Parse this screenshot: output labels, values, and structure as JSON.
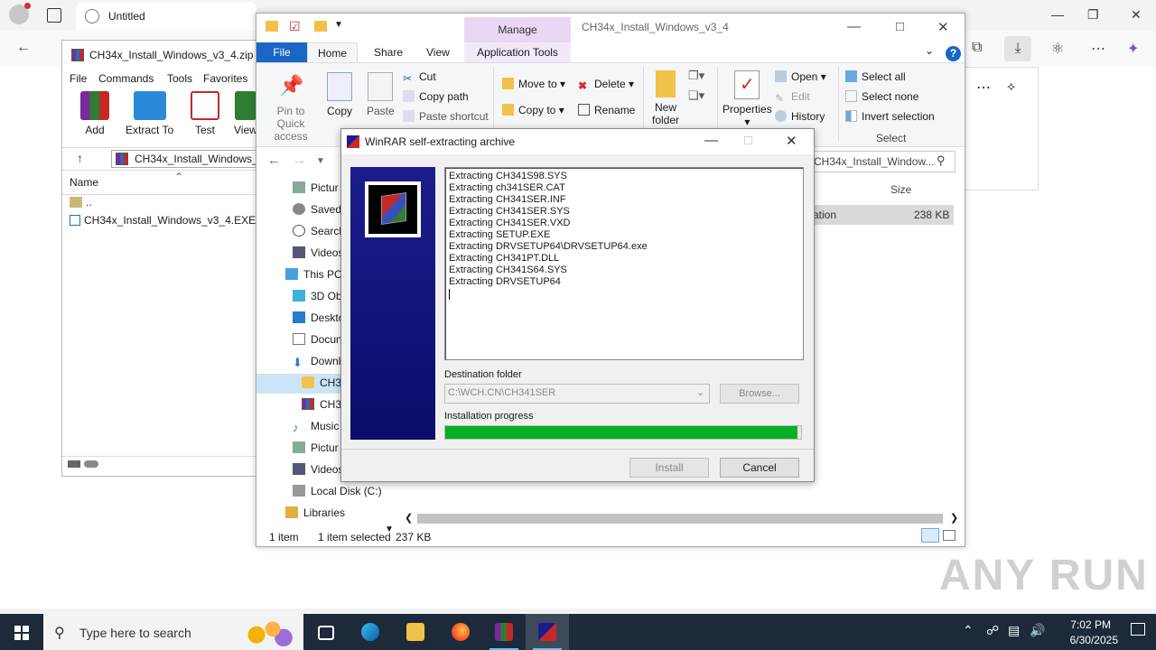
{
  "browser": {
    "tab_title": "Untitled"
  },
  "watermark": "ANY RUN",
  "rar_window": {
    "title": "CH34x_Install_Windows_v3_4.zip",
    "menu": [
      "File",
      "Commands",
      "Tools",
      "Favorites"
    ],
    "tools": [
      "Add",
      "Extract To",
      "Test",
      "View"
    ],
    "path": "CH34x_Install_Windows_v",
    "column_name": "Name",
    "rows": [
      "..",
      "CH34x_Install_Windows_v3_4.EXE"
    ]
  },
  "explorer": {
    "title": "CH34x_Install_Windows_v3_4",
    "manage_label": "Manage",
    "tabs": {
      "file": "File",
      "home": "Home",
      "share": "Share",
      "view": "View",
      "app_tools": "Application Tools"
    },
    "ribbon": {
      "pin": "Pin to Quick access",
      "copy": "Copy",
      "paste": "Paste",
      "cut": "Cut",
      "copy_path": "Copy path",
      "paste_shortcut": "Paste shortcut",
      "move_to": "Move to",
      "copy_to": "Copy to",
      "delete": "Delete",
      "rename": "Rename",
      "new_folder": "New folder",
      "properties": "Properties",
      "open": "Open",
      "edit": "Edit",
      "history": "History",
      "select_all": "Select all",
      "select_none": "Select none",
      "invert_selection": "Invert selection",
      "select_group": "Select"
    },
    "search_placeholder": "CH34x_Install_Window...",
    "nav_items": [
      "Pictur",
      "Saved",
      "Search",
      "Videos",
      "This PC",
      "3D Obj",
      "Deskto",
      "Docun",
      "Downl",
      "CH34",
      "CH34",
      "Music",
      "Pictur",
      "Videos",
      "Local Disk (C:)",
      "Libraries"
    ],
    "column_size": "Size",
    "row_type": "ation",
    "row_size": "238 KB",
    "status": {
      "count": "1 item",
      "selected": "1 item selected",
      "size": "237 KB"
    }
  },
  "sfx_dialog": {
    "title": "WinRAR self-extracting archive",
    "log": [
      "Extracting CH341S98.SYS",
      "Extracting ch341SER.CAT",
      "Extracting CH341SER.INF",
      "Extracting CH341SER.SYS",
      "Extracting CH341SER.VXD",
      "Extracting SETUP.EXE",
      "Extracting DRVSETUP64\\DRVSETUP64.exe",
      "Extracting CH341PT.DLL",
      "Extracting CH341S64.SYS",
      "Extracting DRVSETUP64"
    ],
    "destination_label": "Destination folder",
    "destination_value": "C:\\WCH.CN\\CH341SER",
    "browse_label": "Browse...",
    "progress_label": "Installation progress",
    "progress_fraction": 0.99,
    "install_label": "Install",
    "cancel_label": "Cancel"
  },
  "taskbar": {
    "search_placeholder": "Type here to search",
    "time": "7:02 PM",
    "date": "6/30/2025"
  }
}
